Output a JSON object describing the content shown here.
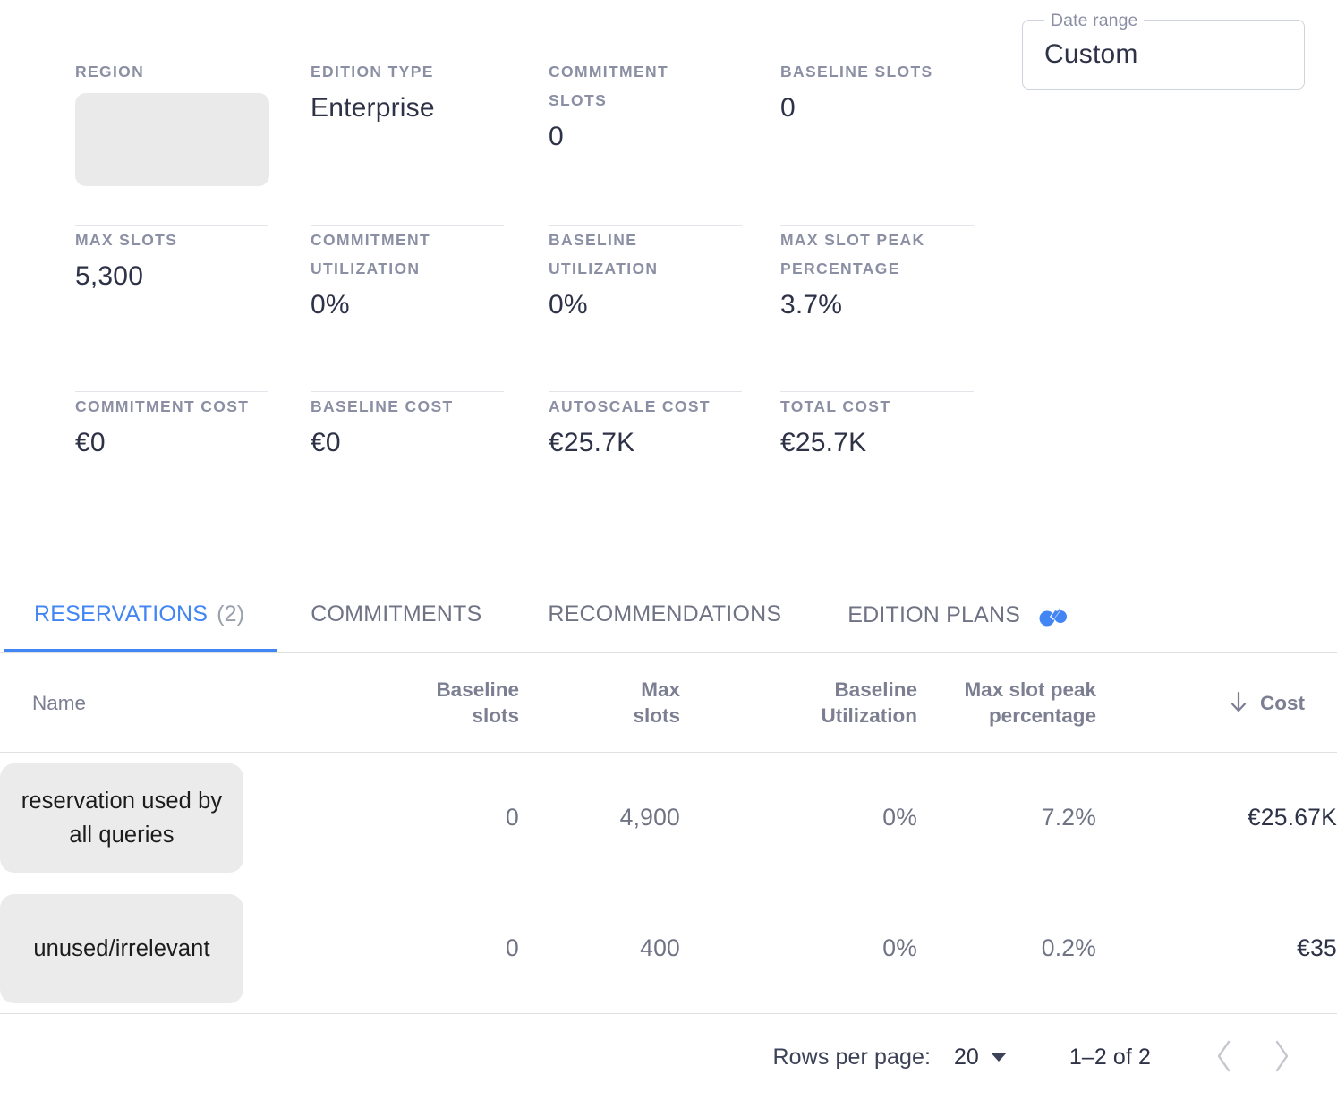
{
  "date_range": {
    "label": "Date range",
    "value": "Custom"
  },
  "metrics": [
    {
      "label": "REGION",
      "value": "",
      "redacted": true
    },
    {
      "label": "EDITION TYPE",
      "value": "Enterprise"
    },
    {
      "label": "COMMITMENT SLOTS",
      "value": "0"
    },
    {
      "label": "BASELINE SLOTS",
      "value": "0"
    },
    {
      "label": "MAX SLOTS",
      "value": "5,300"
    },
    {
      "label": "COMMITMENT UTILIZATION",
      "value": "0%"
    },
    {
      "label": "BASELINE UTILIZATION",
      "value": "0%"
    },
    {
      "label": "MAX SLOT PEAK PERCENTAGE",
      "value": "3.7%"
    },
    {
      "label": "COMMITMENT COST",
      "value": "€0"
    },
    {
      "label": "BASELINE COST",
      "value": "€0"
    },
    {
      "label": "AUTOSCALE COST",
      "value": "€25.7K"
    },
    {
      "label": "TOTAL COST",
      "value": "€25.7K"
    }
  ],
  "tabs": [
    {
      "label": "RESERVATIONS",
      "count": "(2)",
      "active": true
    },
    {
      "label": "COMMITMENTS",
      "count": "",
      "active": false
    },
    {
      "label": "RECOMMENDATIONS",
      "count": "",
      "active": false
    },
    {
      "label": "EDITION PLANS",
      "count": "",
      "active": false,
      "icon": "edition-plans-sparkle-icon"
    }
  ],
  "table": {
    "columns": [
      {
        "key": "name",
        "label": "Name"
      },
      {
        "key": "baseline_slots",
        "label": "Baseline\nslots"
      },
      {
        "key": "max_slots",
        "label": "Max\nslots"
      },
      {
        "key": "baseline_util",
        "label": "Baseline\nUtilization"
      },
      {
        "key": "peak_pct",
        "label": "Max slot peak\npercentage"
      },
      {
        "key": "cost",
        "label": "Cost",
        "sort": "desc",
        "sort_icon": "arrow-down-icon"
      }
    ],
    "rows": [
      {
        "name": "reservation used by all queries",
        "baseline_slots": "0",
        "max_slots": "4,900",
        "baseline_util": "0%",
        "peak_pct": "7.2%",
        "cost": "€25.67K"
      },
      {
        "name": "unused/irrelevant",
        "baseline_slots": "0",
        "max_slots": "400",
        "baseline_util": "0%",
        "peak_pct": "0.2%",
        "cost": "€35"
      }
    ]
  },
  "pagination": {
    "rows_per_page_label": "Rows per page:",
    "rows_per_page_value": "20",
    "range": "1–2 of 2",
    "prev_icon": "chevron-left-icon",
    "next_icon": "chevron-right-icon"
  },
  "colors": {
    "accent": "#4285f4",
    "label": "#8b8fa3",
    "value": "#2e3247",
    "chip_bg": "#ebebeb",
    "divider": "#e0e0e0"
  }
}
